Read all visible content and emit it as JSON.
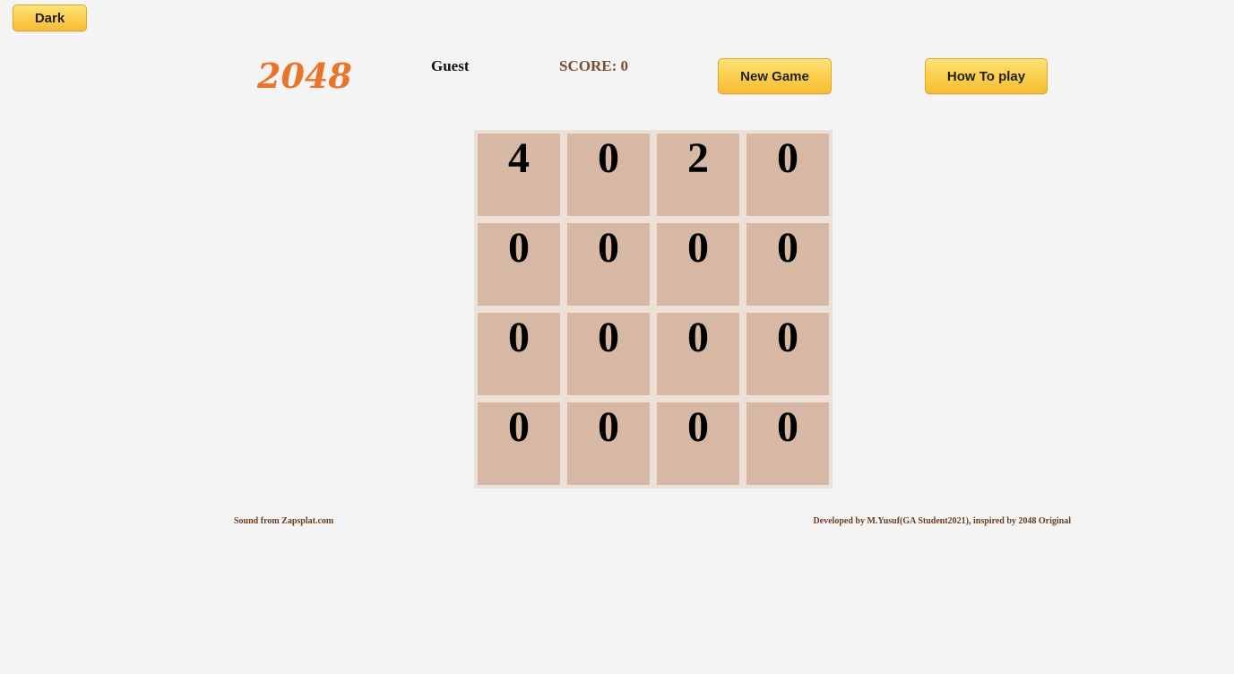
{
  "theme_toggle": {
    "label": "Dark"
  },
  "header": {
    "logo": "2048",
    "player_name": "Guest",
    "score_text": "SCORE: 0",
    "new_game_label": "New Game",
    "how_to_play_label": "How To play"
  },
  "board": {
    "rows": [
      [
        "4",
        "0",
        "2",
        "0"
      ],
      [
        "0",
        "0",
        "0",
        "0"
      ],
      [
        "0",
        "0",
        "0",
        "0"
      ],
      [
        "0",
        "0",
        "0",
        "0"
      ]
    ]
  },
  "footer": {
    "sound_credit": "Sound from Zapsplat.com",
    "dev_credit": "Developed by M.Yusuf(GA Student2021), inspired by 2048 Original"
  },
  "colors": {
    "background": "#f4f4f4",
    "button_gold": "#fbd14f",
    "logo_orange": "#e9752b",
    "tile": "#d6b8a4",
    "board": "#ede0d6",
    "score_brown": "#7a4e33"
  }
}
